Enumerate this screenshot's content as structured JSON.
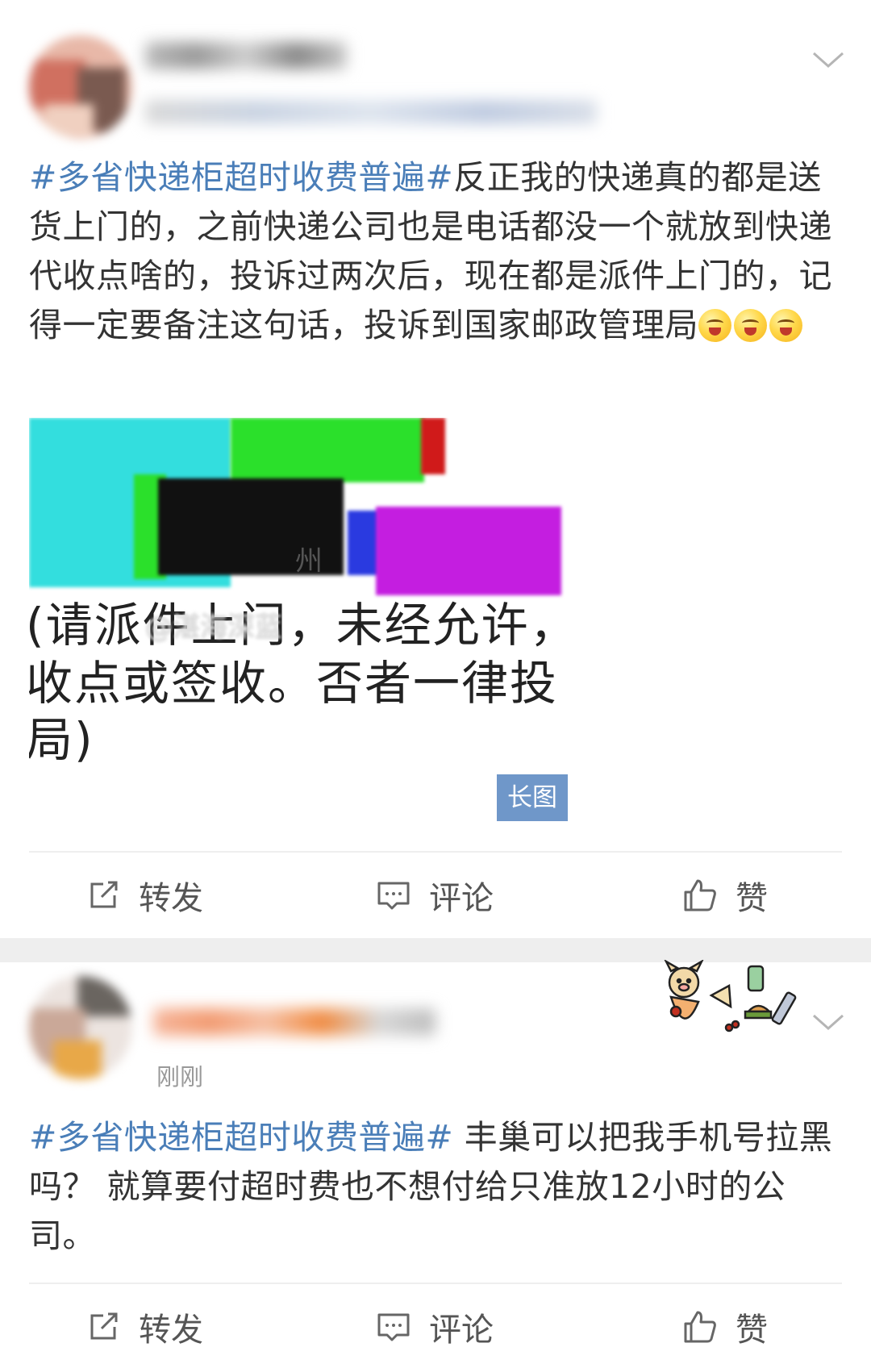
{
  "post1": {
    "topic": "#多省快递柜超时收费普遍#",
    "text": "反正我的快递真的都是送货上门的，之前快递公司也是电话都没一个就放到快递代收点啥的，投诉过两次后，现在都是派件上门的，记得一定要备注这句话，投诉到国家邮政管理局",
    "emoji_icon": "hugging-face-emoji",
    "image": {
      "line1": "(请派件上门，未经允许，",
      "line2": "收点或签收。否者一律投",
      "line3": "局)",
      "partial_word": "州",
      "watermark": "@湛海深蓝",
      "badge": "长图"
    }
  },
  "post2": {
    "timestamp": "刚刚",
    "topic": "#多省快递柜超时收费普遍#",
    "text": " 丰巢可以把我手机号拉黑吗？ 就算要付超时费也不想付给只准放12小时的公司。"
  },
  "actions": {
    "repost": "转发",
    "comment": "评论",
    "like": "赞"
  },
  "colors": {
    "topic": "#4a7eb8",
    "badge": "#6f97c9",
    "separator": "#eeeeee"
  },
  "icons": [
    "share-icon",
    "comment-icon",
    "like-icon",
    "chevron-down-icon"
  ]
}
